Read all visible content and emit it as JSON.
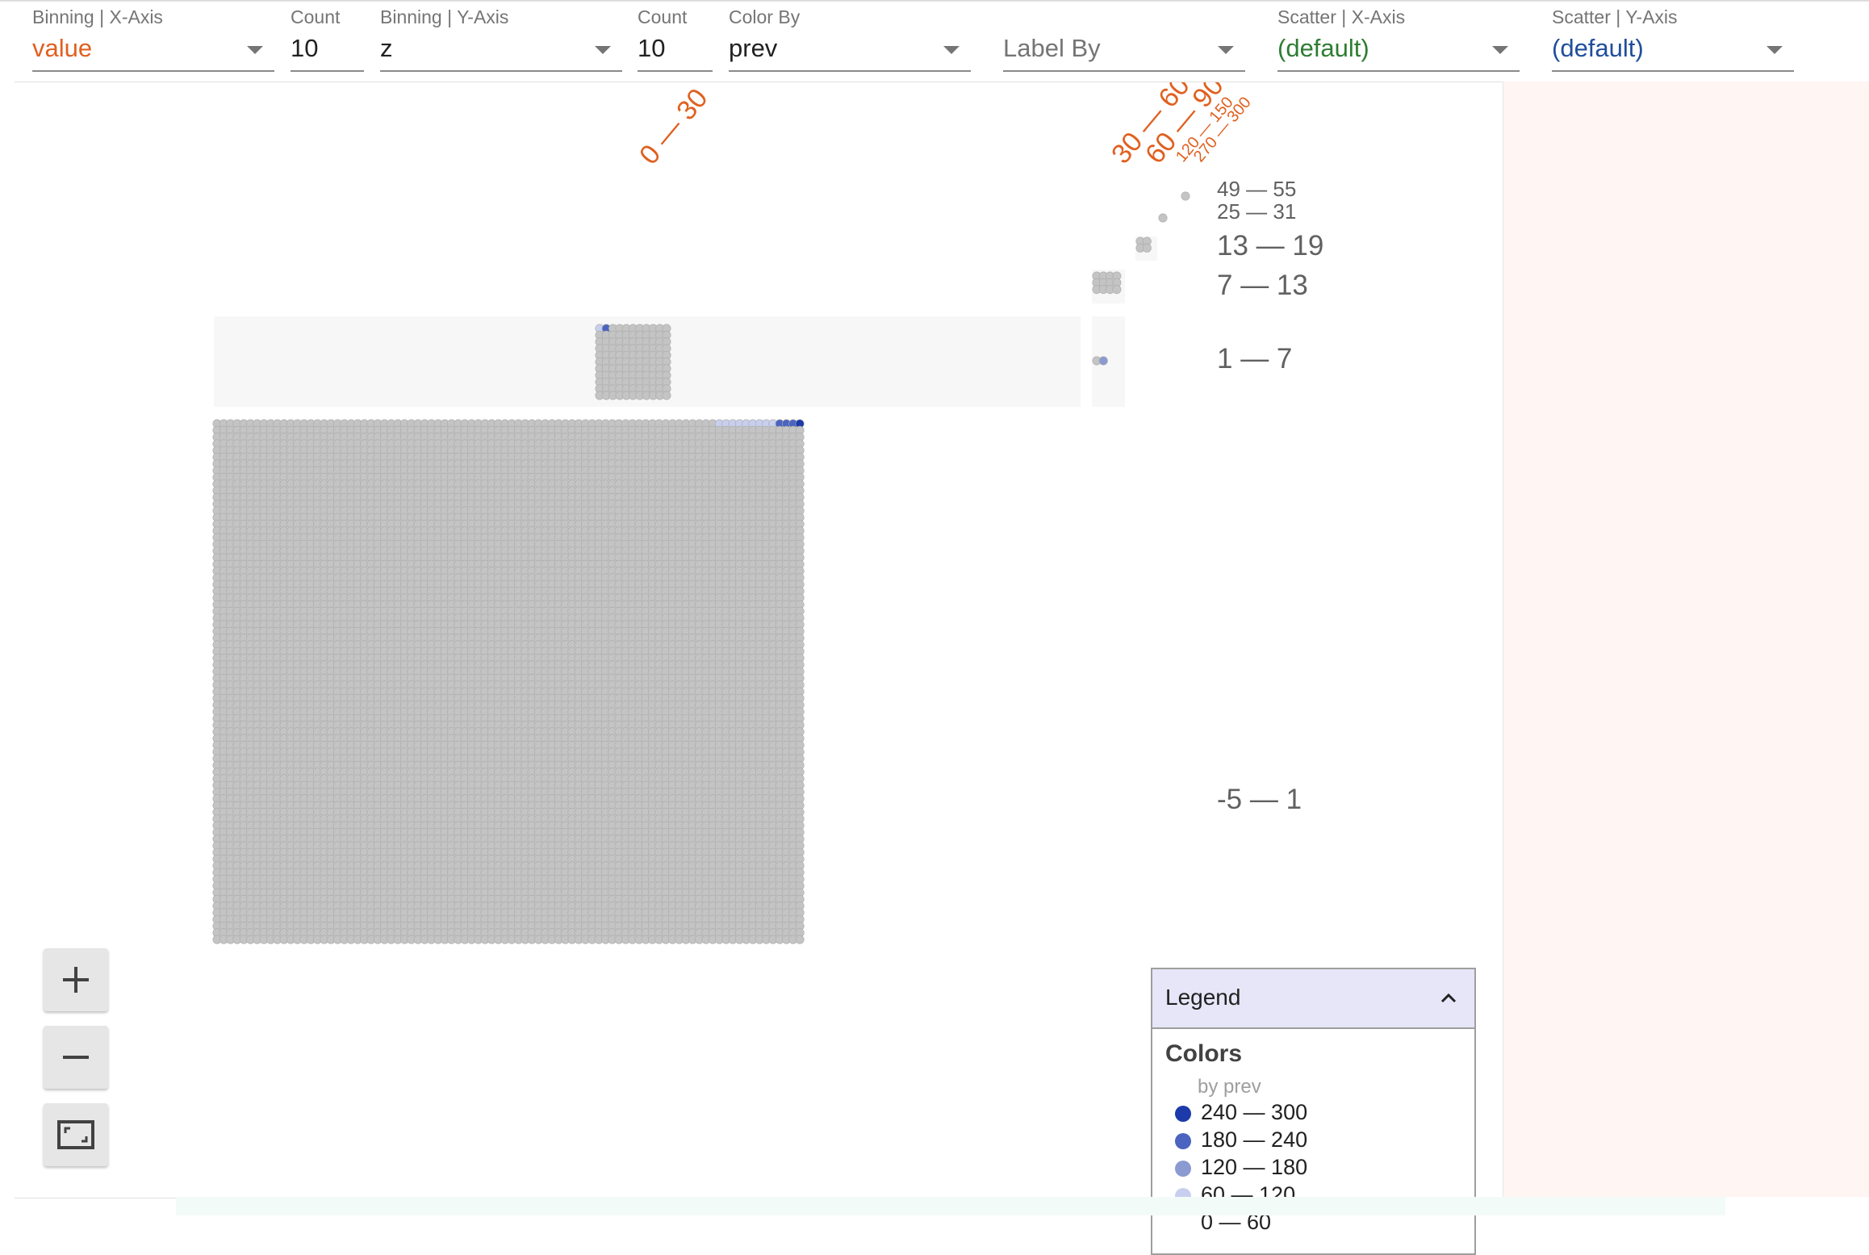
{
  "toolbar": {
    "binning_x": {
      "label": "Binning | X-Axis",
      "value": "value",
      "value_color": "#e0601f"
    },
    "count_x": {
      "label": "Count",
      "value": "10"
    },
    "binning_y": {
      "label": "Binning | Y-Axis",
      "value": "z"
    },
    "count_y": {
      "label": "Count",
      "value": "10"
    },
    "color_by": {
      "label": "Color By",
      "value": "prev"
    },
    "label_by": {
      "placeholder": "Label By"
    },
    "scatter_x": {
      "label": "Scatter | X-Axis",
      "value": "(default)",
      "value_color": "#2e7d32"
    },
    "scatter_y": {
      "label": "Scatter | Y-Axis",
      "value": "(default)",
      "value_color": "#1f4e9c"
    }
  },
  "chart_data": {
    "type": "scatter",
    "x_bins": [
      "0 — 30",
      "30 — 60",
      "60 — 90",
      "120 — 150",
      "270 — 300"
    ],
    "y_bins": [
      "49 — 55",
      "25 — 31",
      "13 — 19",
      "7 — 13",
      "1 — 7",
      "-5 — 1"
    ],
    "colors": {
      "base": "#c4c4c4",
      "highlight": "#f7f7f7",
      "x_label": "#e0601f"
    }
  },
  "zoom": {
    "in_label": "+",
    "out_label": "−"
  },
  "legend": {
    "title": "Legend",
    "section": "Colors",
    "subtitle": "by prev",
    "items": [
      {
        "label": "240 — 300",
        "color": "#1c3aa9"
      },
      {
        "label": "180 — 240",
        "color": "#4a64bf"
      },
      {
        "label": "120 — 180",
        "color": "#8c9ad2"
      },
      {
        "label": "60 — 120",
        "color": "#c8cfee"
      },
      {
        "label": "0 — 60",
        "color": "#ffffff"
      }
    ]
  }
}
